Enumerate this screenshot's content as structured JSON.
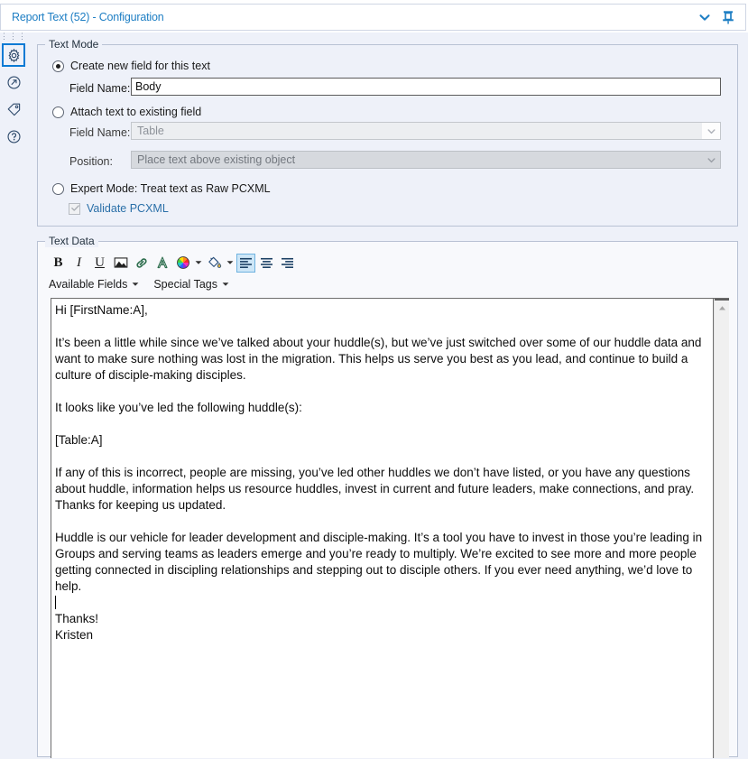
{
  "window": {
    "title": "Report Text (52) - Configuration",
    "collapse_icon": "chevron-down-icon",
    "pin_icon": "pin-icon"
  },
  "rail": {
    "items": [
      {
        "name": "configuration",
        "icon": "gear-icon",
        "selected": true
      },
      {
        "name": "output",
        "icon": "arrow-in-circle-icon",
        "selected": false
      },
      {
        "name": "annotation",
        "icon": "tag-icon",
        "selected": false
      },
      {
        "name": "help",
        "icon": "question-mark-icon",
        "selected": false
      }
    ]
  },
  "text_mode": {
    "legend": "Text Mode",
    "option_create": "Create new field for this text",
    "option_attach": "Attach text to existing field",
    "option_expert": "Expert Mode: Treat text as Raw PCXML",
    "selected_option": "create",
    "create_field_name_label": "Field Name:",
    "create_field_name_value": "Body",
    "attach_field_name_label": "Field Name:",
    "attach_field_name_value": "Table",
    "position_label": "Position:",
    "position_value": "Place text above existing object",
    "validate_label": "Validate PCXML",
    "validate_checked": true
  },
  "text_data": {
    "legend": "Text Data",
    "toolbar": [
      {
        "name": "bold-button",
        "glyph": "B",
        "active": false
      },
      {
        "name": "italic-button",
        "glyph": "I",
        "active": false
      },
      {
        "name": "underline-button",
        "glyph": "U",
        "active": false
      },
      {
        "name": "insert-image-button",
        "icon": "image-icon",
        "active": false
      },
      {
        "name": "insert-link-button",
        "icon": "link-icon",
        "active": false
      },
      {
        "name": "font-button",
        "icon": "font-a-icon",
        "active": false
      },
      {
        "name": "text-color-button",
        "icon": "color-wheel-icon",
        "active": false
      },
      {
        "name": "fill-color-button",
        "icon": "paint-bucket-icon",
        "active": false
      },
      {
        "name": "align-left-button",
        "icon": "align-left-icon",
        "active": true
      },
      {
        "name": "align-center-button",
        "icon": "align-center-icon",
        "active": false
      },
      {
        "name": "align-right-button",
        "icon": "align-right-icon",
        "active": false
      }
    ],
    "menus": [
      {
        "name": "available-fields-menu",
        "label": "Available Fields"
      },
      {
        "name": "special-tags-menu",
        "label": "Special Tags"
      }
    ],
    "body_paragraphs": [
      "Hi [FirstName:A],",
      "",
      "It’s been a little while since we’ve talked about your huddle(s), but we’ve just switched over some of our huddle data and want to make sure nothing was lost in the migration. This helps us serve you best as you lead, and continue to build a culture of disciple-making disciples.",
      "",
      "It looks like you’ve led the following huddle(s):",
      "",
      "[Table:A]",
      "",
      "If any of this is incorrect, people are missing, you’ve led other huddles we don’t have listed, or you have any questions about huddle, information helps us resource huddles, invest in current and future leaders, make connections, and pray. Thanks for keeping us updated.",
      "",
      "Huddle is our vehicle for leader development and disciple-making. It’s a tool you have to invest in those you’re leading in Groups and serving teams as leaders emerge and you’re ready to multiply. We’re excited to see more and more people getting connected in discipling relationships and stepping out to disciple others. If you ever need anything, we’d love to help.",
      "",
      "Thanks!",
      "Kristen"
    ],
    "caret_after_paragraph_index": 11
  },
  "colors": {
    "accent": "#1f7fc4",
    "panel_bg": "#eef1f9",
    "editor_bg": "#ffffff",
    "group_border": "#b9c2d4",
    "toolbar_active_bg": "#cde6f7"
  }
}
